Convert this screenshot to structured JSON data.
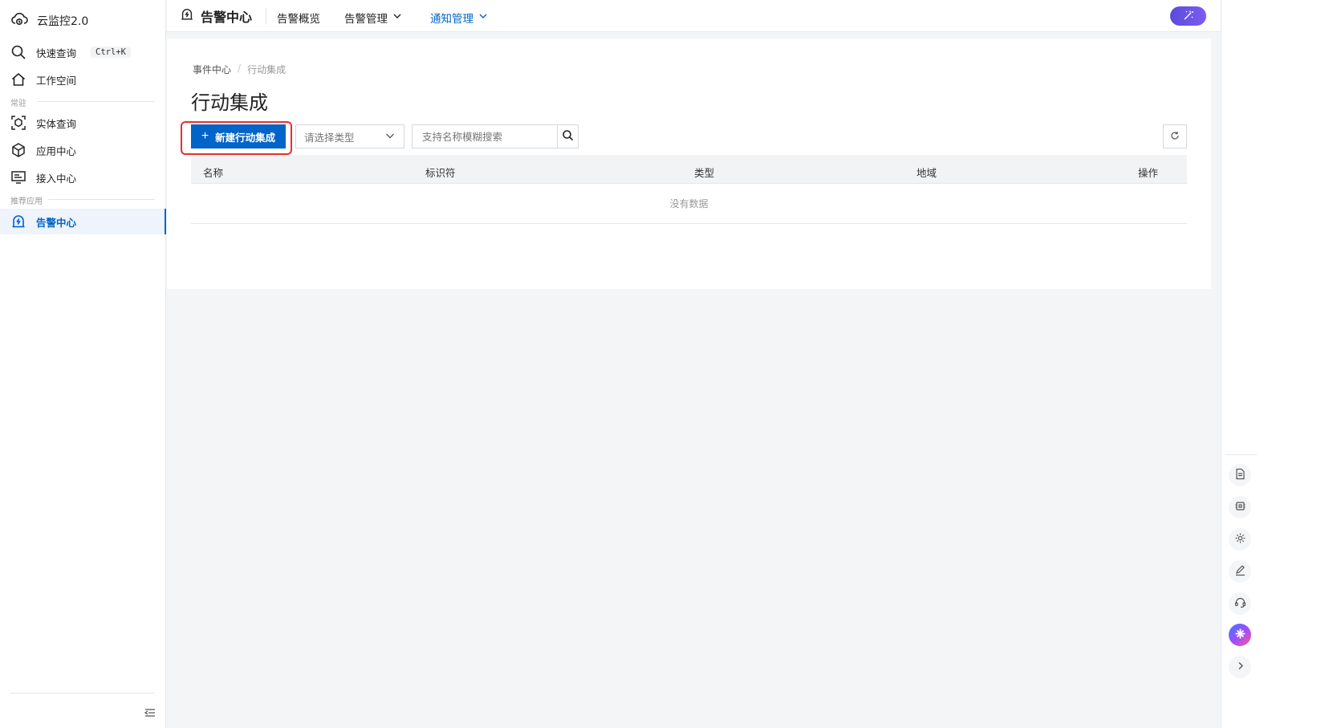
{
  "sidebar": {
    "brand": "云监控2.0",
    "quick_search": {
      "label": "快速查询",
      "shortcut": "Ctrl+K"
    },
    "workspace": "工作空间",
    "group_common": "常驻",
    "items_common": [
      {
        "label": "实体查询",
        "icon": "entity-scan-icon"
      },
      {
        "label": "应用中心",
        "icon": "cube-icon"
      },
      {
        "label": "接入中心",
        "icon": "monitor-icon"
      }
    ],
    "group_recommend": "推荐应用",
    "active_item": {
      "label": "告警中心",
      "icon": "alarm-icon"
    }
  },
  "topbar": {
    "title": "告警中心",
    "tabs": [
      {
        "label": "告警概览",
        "dropdown": false
      },
      {
        "label": "告警管理",
        "dropdown": true
      },
      {
        "label": "通知管理",
        "dropdown": true,
        "active": true
      }
    ]
  },
  "main": {
    "breadcrumb": [
      "事件中心",
      "行动集成"
    ],
    "breadcrumb_separator": "/",
    "page_title": "行动集成",
    "create_button": "新建行动集成",
    "type_select": {
      "placeholder": "请选择类型"
    },
    "search": {
      "placeholder": "支持名称模糊搜索",
      "value": ""
    },
    "table": {
      "columns": [
        "名称",
        "标识符",
        "类型",
        "地域",
        "操作"
      ],
      "rows": [],
      "empty_text": "没有数据"
    }
  },
  "colors": {
    "primary": "#0064c8",
    "highlight_box": "#e8302b",
    "ai_gradient": "#6b55e8"
  }
}
